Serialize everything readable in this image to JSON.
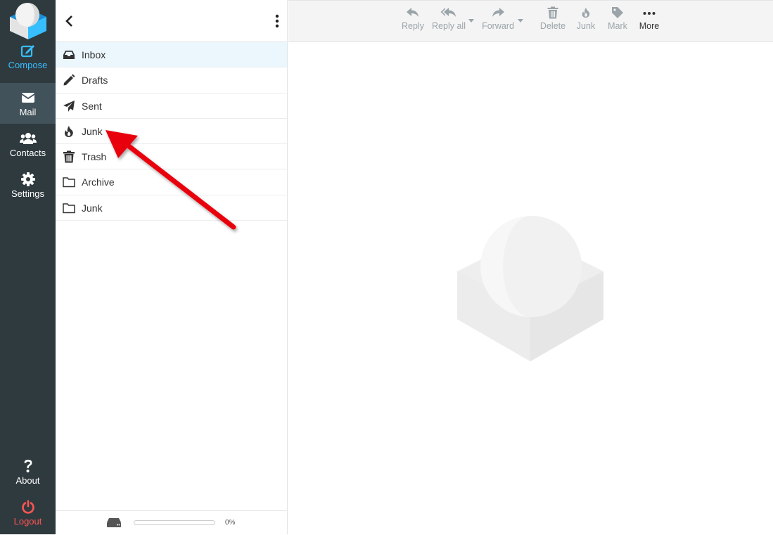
{
  "nav": {
    "compose": "Compose",
    "mail": "Mail",
    "contacts": "Contacts",
    "settings": "Settings",
    "about": "About",
    "logout": "Logout"
  },
  "folders": [
    {
      "label": "Inbox",
      "icon": "inbox-icon",
      "selected": true
    },
    {
      "label": "Drafts",
      "icon": "pencil-icon",
      "selected": false
    },
    {
      "label": "Sent",
      "icon": "paper-plane-icon",
      "selected": false
    },
    {
      "label": "Junk",
      "icon": "fire-icon",
      "selected": false
    },
    {
      "label": "Trash",
      "icon": "trash-icon",
      "selected": false
    },
    {
      "label": "Archive",
      "icon": "folder-icon",
      "selected": false
    },
    {
      "label": "Junk",
      "icon": "folder-icon",
      "selected": false
    }
  ],
  "quota": {
    "text": "0%",
    "fraction": 0.0
  },
  "toolbar": {
    "reply": "Reply",
    "reply_all": "Reply all",
    "forward": "Forward",
    "delete": "Delete",
    "junk": "Junk",
    "mark": "Mark",
    "more": "More"
  },
  "colors": {
    "nav_bg": "#2f3a3f",
    "nav_active": "#41525a",
    "compose": "#37beff",
    "logout": "#ff5552",
    "annotation_arrow": "#e8000b"
  }
}
